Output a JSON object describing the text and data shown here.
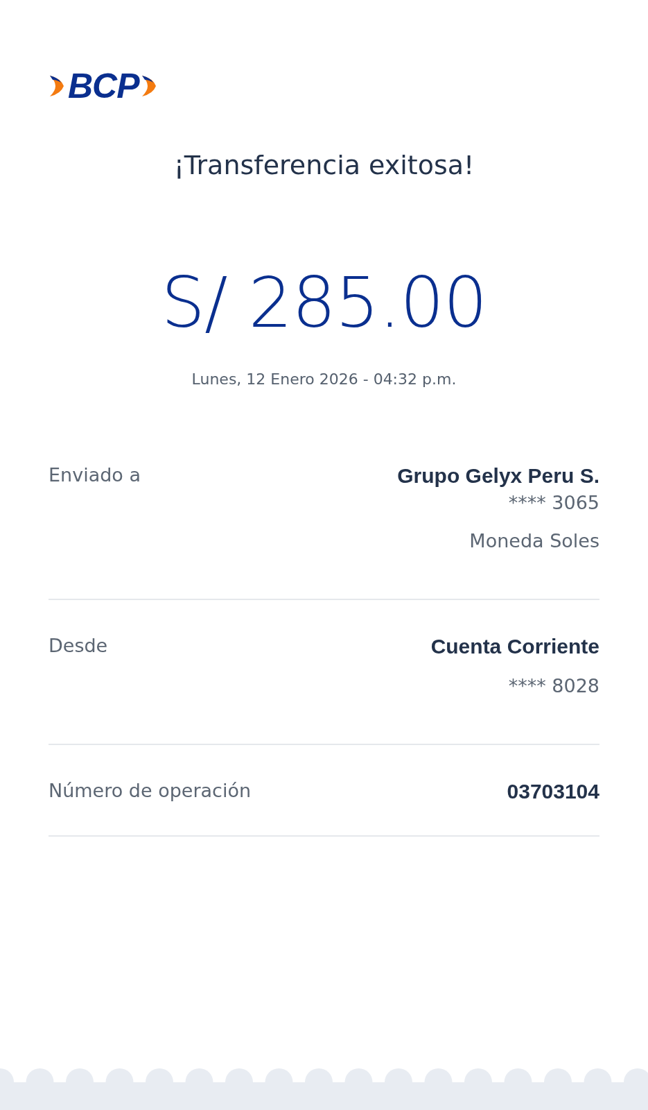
{
  "logo": "BCP",
  "title": "¡Transferencia exitosa!",
  "amount": "S/ 285.00",
  "datetime": "Lunes, 12 Enero 2026 - 04:32 p.m.",
  "details": [
    {
      "label": "Enviado a",
      "lines": [
        {
          "kind": "name",
          "text": "Grupo Gelyx Peru S."
        },
        {
          "kind": "account",
          "text": "**** 3065"
        },
        {
          "kind": "note",
          "text": "Moneda Soles"
        }
      ]
    },
    {
      "label": "Desde",
      "lines": [
        {
          "kind": "name",
          "text": "Cuenta Corriente"
        },
        {
          "kind": "note",
          "text": "**** 8028"
        }
      ]
    },
    {
      "label": "Número de operación",
      "lines": [
        {
          "kind": "name",
          "text": "03703104"
        }
      ]
    }
  ]
}
